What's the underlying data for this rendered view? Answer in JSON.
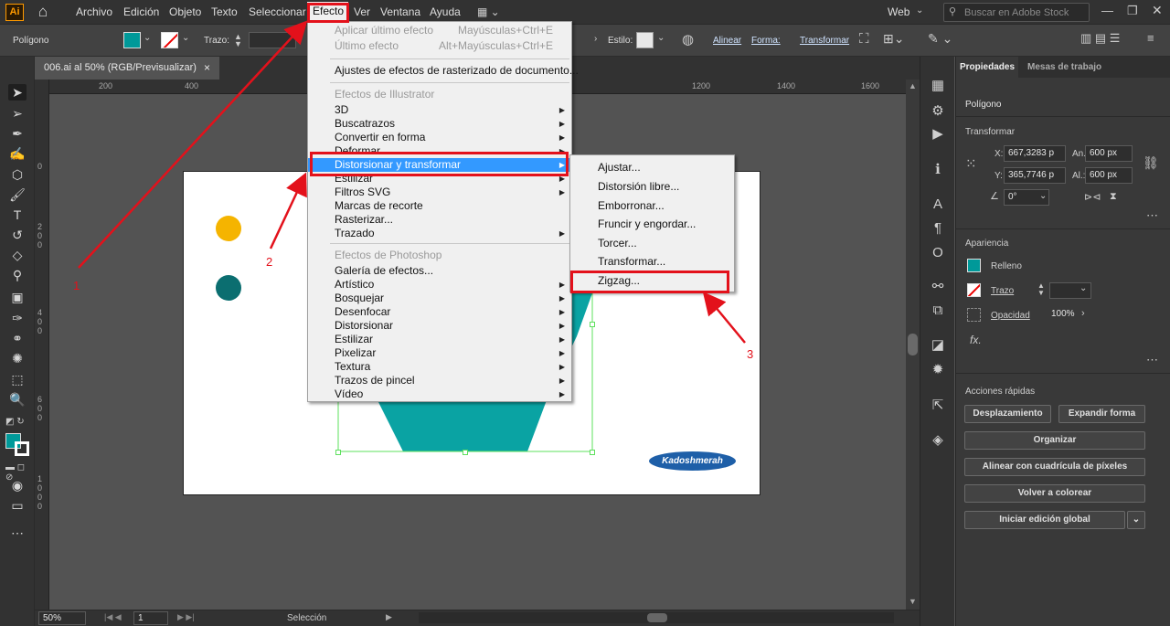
{
  "app": {
    "logo": "Ai"
  },
  "menubar": {
    "items": [
      "Archivo",
      "Edición",
      "Objeto",
      "Texto",
      "Seleccionar",
      "Efecto",
      "Ver",
      "Ventana",
      "Ayuda"
    ],
    "workspace": "Web",
    "search_placeholder": "Buscar en Adobe Stock"
  },
  "control": {
    "object_type": "Polígono",
    "stroke_label": "Trazo:",
    "style_label": "Estilo:",
    "align_label": "Alinear",
    "shape_label": "Forma:",
    "transform_label": "Transformar",
    "fill_color": "#009999"
  },
  "document": {
    "tab_title": "006.ai al 50% (RGB/Previsualizar)",
    "close": "×"
  },
  "ruler": {
    "h_ticks": [
      "200",
      "400",
      "1200",
      "1400",
      "1600"
    ],
    "v_ticks": [
      "0",
      "2",
      "0",
      "0",
      "4",
      "0",
      "0",
      "6",
      "0",
      "0",
      "1",
      "0",
      "0",
      "0"
    ]
  },
  "effect_menu": {
    "apply_last": "Aplicar último efecto",
    "apply_last_sc": "Mayúsculas+Ctrl+E",
    "last": "Último efecto",
    "last_sc": "Alt+Mayúsculas+Ctrl+E",
    "raster_settings": "Ajustes de efectos de rasterizado de documento...",
    "illustrator_header": "Efectos de Illustrator",
    "illustrator_items": [
      "3D",
      "Buscatrazos",
      "Convertir en forma",
      "Deformar",
      "Distorsionar y transformar",
      "Estilizar",
      "Filtros SVG",
      "Marcas de recorte",
      "Rasterizar...",
      "Trazado"
    ],
    "photoshop_header": "Efectos de Photoshop",
    "photoshop_items": [
      "Galería de efectos...",
      "Artístico",
      "Bosquejar",
      "Desenfocar",
      "Distorsionar",
      "Estilizar",
      "Pixelizar",
      "Textura",
      "Trazos de pincel",
      "Vídeo"
    ]
  },
  "submenu": {
    "items": [
      "Ajustar...",
      "Distorsión libre...",
      "Emborronar...",
      "Fruncir y engordar...",
      "Torcer...",
      "Transformar...",
      "Zigzag..."
    ]
  },
  "annotations": {
    "one": "1",
    "two": "2",
    "three": "3",
    "color": "#e3111b"
  },
  "artboard": {
    "watermark": "Kadoshmerah",
    "dot1_color": "#f5b400",
    "dot2_color": "#0b6e70",
    "shape_color": "#0aa3a3"
  },
  "properties": {
    "tabs": [
      "Propiedades",
      "Mesas de trabajo"
    ],
    "object": "Polígono",
    "transform_title": "Transformar",
    "x_label": "X:",
    "x_value": "667,3283 p",
    "y_label": "Y:",
    "y_value": "365,7746 p",
    "w_label": "An.:",
    "w_value": "600 px",
    "h_label": "Al.:",
    "h_value": "600 px",
    "angle_value": "0°",
    "appearance_title": "Apariencia",
    "fill_label": "Relleno",
    "stroke_label": "Trazo",
    "opacity_label": "Opacidad",
    "opacity_value": "100%",
    "fx": "fx.",
    "quick_title": "Acciones rápidas",
    "buttons": [
      "Desplazamiento",
      "Expandir forma",
      "Organizar",
      "Alinear con cuadrícula de píxeles",
      "Volver a colorear",
      "Iniciar edición global"
    ]
  },
  "status": {
    "zoom": "50%",
    "artboard_num": "1",
    "tool": "Selección"
  }
}
